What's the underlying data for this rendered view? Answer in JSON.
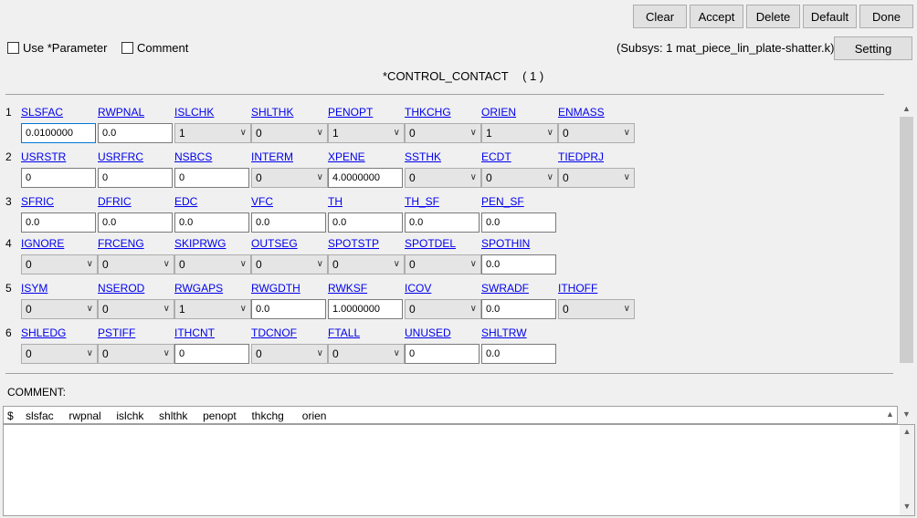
{
  "toolbar": {
    "clear": "Clear",
    "accept": "Accept",
    "delete": "Delete",
    "default": "Default",
    "done": "Done",
    "setting": "Setting"
  },
  "options": {
    "use_parameter": "Use *Parameter",
    "comment": "Comment"
  },
  "subsys": "(Subsys: 1 mat_piece_lin_plate-shatter.k)",
  "title": "*CONTROL_CONTACT",
  "title_count": "( 1 )",
  "rows": [
    {
      "num": "1",
      "labels": [
        "SLSFAC",
        "RWPNAL",
        "ISLCHK",
        "SHLTHK",
        "PENOPT",
        "THKCHG",
        "ORIEN",
        "ENMASS"
      ],
      "values": [
        "0.0100000",
        "0.0",
        "1",
        "0",
        "1",
        "0",
        "1",
        "0"
      ]
    },
    {
      "num": "2",
      "labels": [
        "USRSTR",
        "USRFRC",
        "NSBCS",
        "INTERM",
        "XPENE",
        "SSTHK",
        "ECDT",
        "TIEDPRJ"
      ],
      "values": [
        "0",
        "0",
        "0",
        "0",
        "4.0000000",
        "0",
        "0",
        "0"
      ]
    },
    {
      "num": "3",
      "labels": [
        "SFRIC",
        "DFRIC",
        "EDC",
        "VFC",
        "TH",
        "TH_SF",
        "PEN_SF"
      ],
      "values": [
        "0.0",
        "0.0",
        "0.0",
        "0.0",
        "0.0",
        "0.0",
        "0.0"
      ]
    },
    {
      "num": "4",
      "labels": [
        "IGNORE",
        "FRCENG",
        "SKIPRWG",
        "OUTSEG",
        "SPOTSTP",
        "SPOTDEL",
        "SPOTHIN"
      ],
      "values": [
        "0",
        "0",
        "0",
        "0",
        "0",
        "0",
        "0.0"
      ]
    },
    {
      "num": "5",
      "labels": [
        "ISYM",
        "NSEROD",
        "RWGAPS",
        "RWGDTH",
        "RWKSF",
        "ICOV",
        "SWRADF",
        "ITHOFF"
      ],
      "values": [
        "0",
        "0",
        "1",
        "0.0",
        "1.0000000",
        "0",
        "0.0",
        "0"
      ]
    },
    {
      "num": "6",
      "labels": [
        "SHLEDG",
        "PSTIFF",
        "ITHCNT",
        "TDCNOF",
        "FTALL",
        "UNUSED",
        "SHLTRW"
      ],
      "values": [
        "0",
        "0",
        "0",
        "0",
        "0",
        "0",
        "0.0"
      ]
    }
  ],
  "comment_label": "COMMENT:",
  "comment_line": "$    slsfac     rwpnal     islchk     shlthk     penopt     thkchg      orien"
}
